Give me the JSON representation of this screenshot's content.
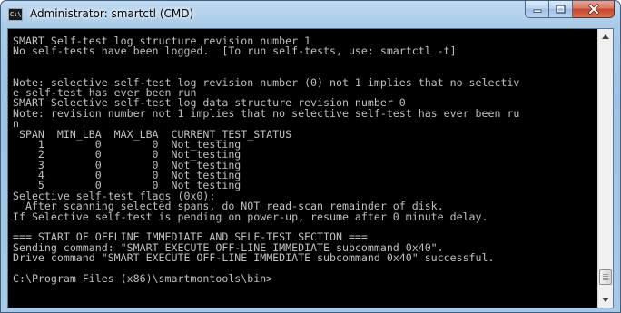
{
  "window": {
    "title": "Administrator: smartctl (CMD)",
    "icon": "cmd-icon",
    "icon_text": "C:\\"
  },
  "caption_buttons": [
    {
      "name": "minimize-button",
      "icon": "minimize-icon"
    },
    {
      "name": "maximize-button",
      "icon": "maximize-icon"
    },
    {
      "name": "close-button",
      "icon": "close-icon"
    }
  ],
  "console": {
    "lines": [
      "SMART Self-test log structure revision number 1",
      "No self-tests have been logged.  [To run self-tests, use: smartctl -t]",
      "",
      "",
      "Note: selective self-test log revision number (0) not 1 implies that no selectiv",
      "e self-test has ever been run",
      "SMART Selective self-test log data structure revision number 0",
      "Note: revision number not 1 implies that no selective self-test has ever been ru",
      "n",
      " SPAN  MIN_LBA  MAX_LBA  CURRENT_TEST_STATUS",
      "    1        0        0  Not_testing",
      "    2        0        0  Not_testing",
      "    3        0        0  Not_testing",
      "    4        0        0  Not_testing",
      "    5        0        0  Not_testing",
      "Selective self-test flags (0x0):",
      "  After scanning selected spans, do NOT read-scan remainder of disk.",
      "If Selective self-test is pending on power-up, resume after 0 minute delay.",
      "",
      "=== START OF OFFLINE IMMEDIATE AND SELF-TEST SECTION ===",
      "Sending command: \"SMART EXECUTE OFF-LINE IMMEDIATE subcommand 0x40\".",
      "Drive command \"SMART EXECUTE OFF-LINE IMMEDIATE subcommand 0x40\" successful.",
      "",
      "C:\\Program Files (x86)\\smartmontools\\bin>"
    ]
  },
  "scrollbar": {
    "up_icon": "scroll-up-icon",
    "down_icon": "scroll-down-icon",
    "position": 0.97
  },
  "colors": {
    "console_bg": "#000000",
    "console_text": "#c0c0c0",
    "close_button": "#c7452b",
    "frame": "#a7c9e6"
  }
}
